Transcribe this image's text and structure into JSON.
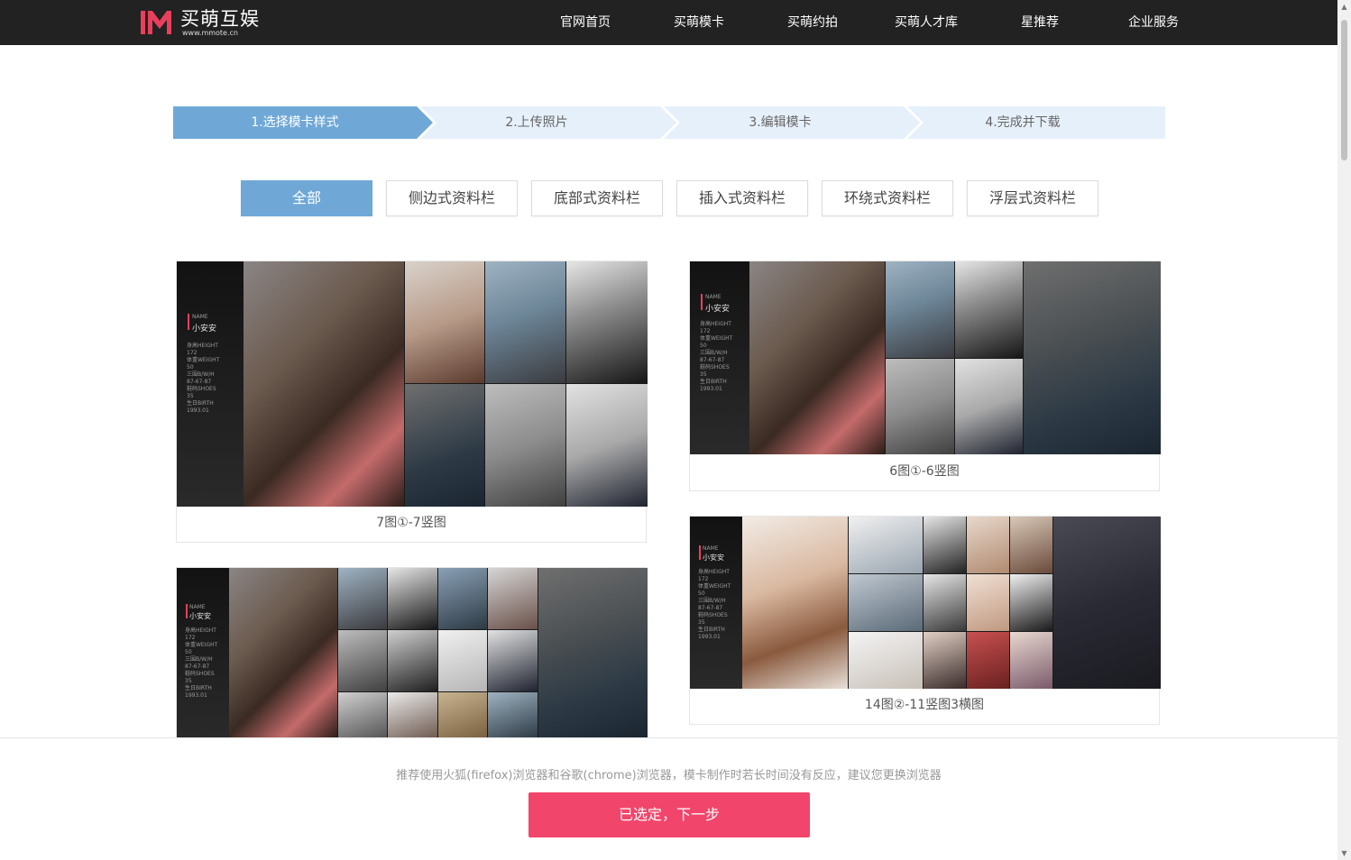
{
  "header": {
    "logo_name": "买萌互娱",
    "logo_url": "www.mmote.cn",
    "nav": [
      "官网首页",
      "买萌模卡",
      "买萌约拍",
      "买萌人才库",
      "星推荐",
      "企业服务"
    ]
  },
  "steps": [
    "1.选择模卡样式",
    "2.上传照片",
    "3.编辑模卡",
    "4.完成并下载"
  ],
  "filters": [
    "全部",
    "侧边式资料栏",
    "底部式资料栏",
    "插入式资料栏",
    "环绕式资料栏",
    "浮层式资料栏"
  ],
  "cards": [
    {
      "caption": "7图①-7竖图"
    },
    {
      "caption": "6图①-6竖图"
    },
    {
      "caption": ""
    },
    {
      "caption": "14图②-11竖图3横图"
    }
  ],
  "profile": {
    "name_label": "NAME",
    "name": "小安安",
    "lines": "身高HEIGHT\n172\n体重WEIGHT\n50\n三围B/W/H\n87-67-87\n鞋码SHOES\n35\n生日BIRTH\n1993.01"
  },
  "footer": {
    "notice": "推荐使用火狐(firefox)浏览器和谷歌(chrome)浏览器，模卡制作时若长时间没有反应，建议您更换浏览器",
    "next_button": "已选定，下一步"
  },
  "colors": {
    "header_bg": "#222222",
    "step_active": "#6fa8d6",
    "step_inactive": "#e6f0fa",
    "accent": "#f2456b"
  }
}
